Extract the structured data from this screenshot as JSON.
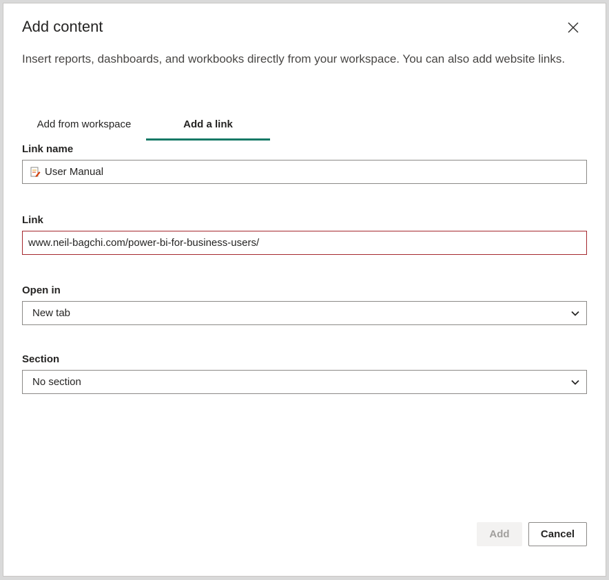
{
  "dialog": {
    "title": "Add content",
    "description": "Insert reports, dashboards, and workbooks directly from your workspace. You can also add website links."
  },
  "tabs": [
    {
      "label": "Add from workspace",
      "active": false
    },
    {
      "label": "Add a link",
      "active": true
    }
  ],
  "form": {
    "link_name": {
      "label": "Link name",
      "value": "User Manual",
      "icon": "edit-document-icon"
    },
    "link": {
      "label": "Link",
      "value": "www.neil-bagchi.com/power-bi-for-business-users/",
      "error": true
    },
    "open_in": {
      "label": "Open in",
      "value": "New tab"
    },
    "section": {
      "label": "Section",
      "value": "No section"
    }
  },
  "buttons": {
    "add": "Add",
    "cancel": "Cancel"
  },
  "colors": {
    "accent": "#117865",
    "error_border": "#a4262c"
  }
}
